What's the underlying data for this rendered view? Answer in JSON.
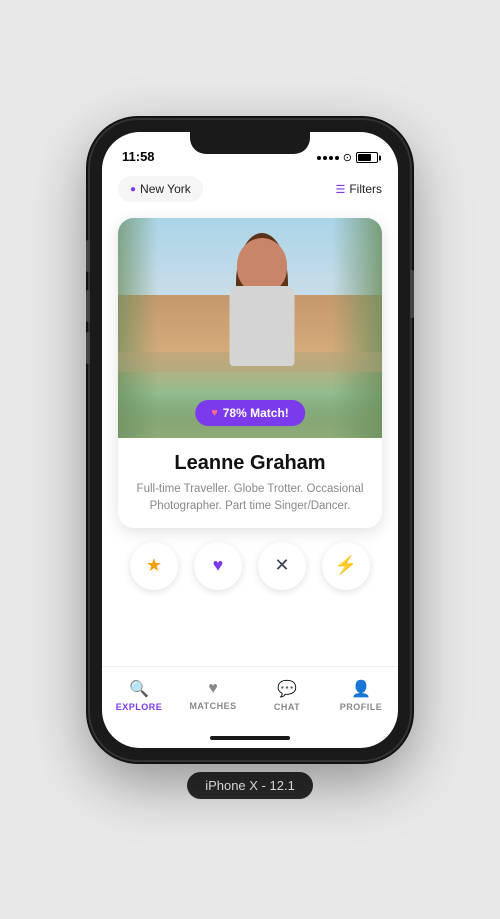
{
  "device": {
    "label": "iPhone X - 12.1",
    "time": "11:58"
  },
  "header": {
    "location": "New York",
    "filter_label": "Filters"
  },
  "profile": {
    "match_percent": "78% Match!",
    "name": "Leanne Graham",
    "bio": "Full-time Traveller. Globe Trotter. Occasional Photographer. Part time Singer/Dancer."
  },
  "actions": {
    "star_label": "★",
    "heart_label": "♥",
    "cross_label": "✕",
    "bolt_label": "⚡"
  },
  "nav": {
    "items": [
      {
        "id": "explore",
        "label": "EXPLORE",
        "active": true
      },
      {
        "id": "matches",
        "label": "MATCHES",
        "active": false
      },
      {
        "id": "chat",
        "label": "CHAT",
        "active": false
      },
      {
        "id": "profile",
        "label": "PROFILE",
        "active": false
      }
    ]
  }
}
